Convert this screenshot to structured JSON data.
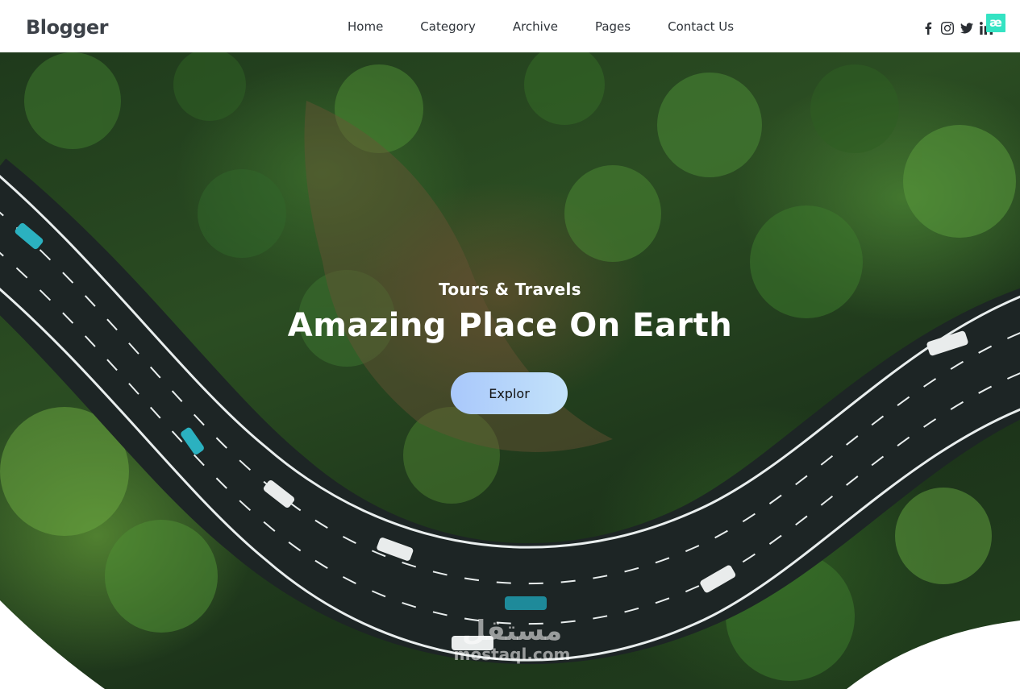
{
  "header": {
    "logo": "Blogger",
    "nav": [
      "Home",
      "Category",
      "Archive",
      "Pages",
      "Contact Us"
    ],
    "social": [
      "facebook-icon",
      "instagram-icon",
      "twitter-icon",
      "linkedin-icon"
    ],
    "badge": "æ"
  },
  "hero": {
    "subtitle": "Tours & Travels",
    "title": "Amazing Place On Earth",
    "button_label": "Explor"
  },
  "watermark": {
    "arabic": "مستقل",
    "latin": "mostaql.com"
  },
  "colors": {
    "logo": "#3c4148",
    "badge": "#34e3c3",
    "button_gradient_start": "#a9c8fb",
    "button_gradient_end": "#c3e2fa"
  }
}
